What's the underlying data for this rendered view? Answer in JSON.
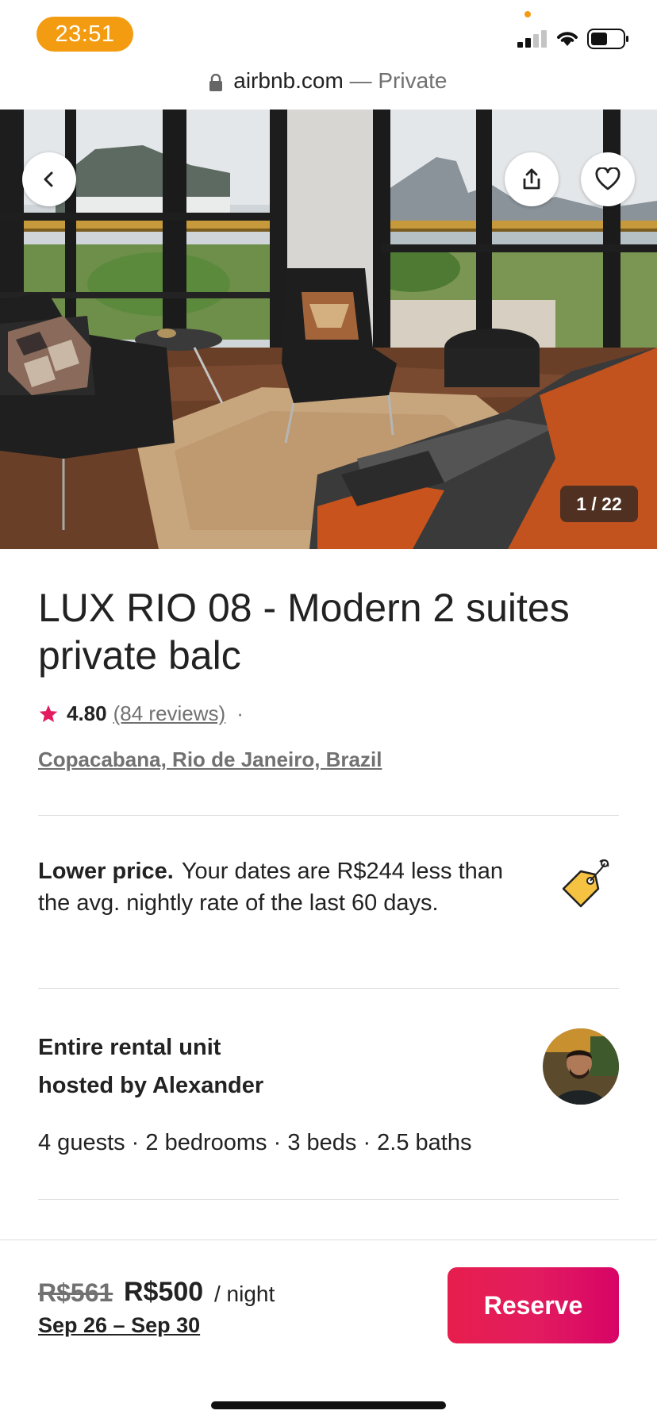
{
  "status_bar": {
    "time": "23:51"
  },
  "browser": {
    "domain": "airbnb.com",
    "separator": "—",
    "mode": "Private"
  },
  "hero": {
    "photo_counter": "1 / 22",
    "icons": {
      "back": "chevron-left-icon",
      "share": "share-icon",
      "save": "heart-icon"
    }
  },
  "listing": {
    "title": "LUX RIO 08 - Modern 2 suites private balc",
    "rating": "4.80",
    "reviews": "(84 reviews)",
    "dot": "·",
    "location": "Copacabana, Rio de Janeiro, Brazil"
  },
  "lower_price": {
    "heading": "Lower price.",
    "text": "Your dates are R$244 less than the avg. nightly rate of the last 60 days."
  },
  "host": {
    "line1": "Entire rental unit",
    "line2": "hosted by Alexander",
    "details": "4 guests · 2 bedrooms · 3 beds · 2.5 baths"
  },
  "booking": {
    "old_price": "R$561",
    "new_price": "R$500",
    "per_night": "/ night",
    "dates": "Sep 26 – Sep 30",
    "reserve_label": "Reserve"
  },
  "colors": {
    "brand": "#E31C5F",
    "time_pill": "#F39C12",
    "secondary_text": "#717171",
    "divider": "#DDDDDD"
  }
}
